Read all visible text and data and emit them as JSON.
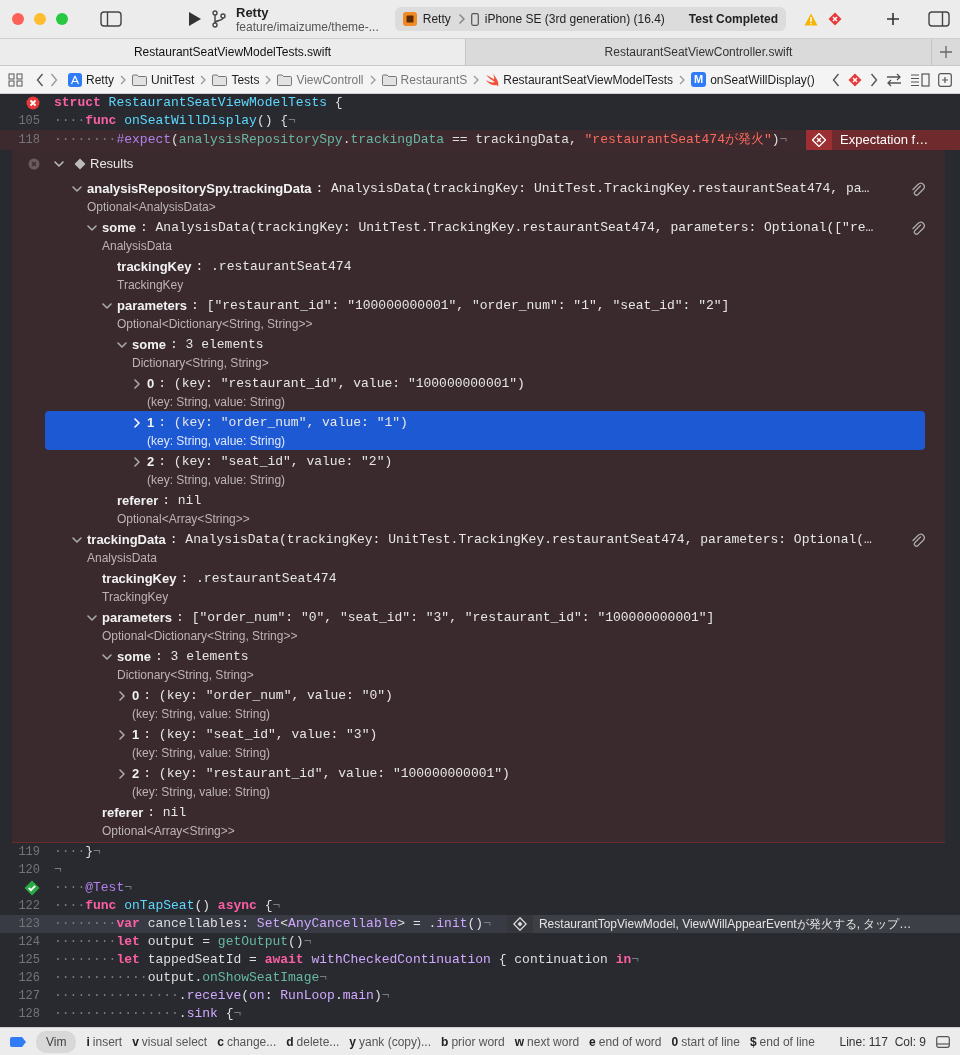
{
  "window": {
    "project": "Retty",
    "branch": "feature/imaizume/theme-...",
    "scheme": "Retty",
    "device": "iPhone SE (3rd generation) (16.4)",
    "status": "Test Completed"
  },
  "tabs": [
    {
      "label": "RestaurantSeatViewModelTests.swift",
      "selected": true
    },
    {
      "label": "RestaurantSeatViewController.swift",
      "selected": false
    }
  ],
  "breadcrumbs": [
    {
      "label": "Retty",
      "kind": "project"
    },
    {
      "label": "UnitTest",
      "kind": "folder"
    },
    {
      "label": "Tests",
      "kind": "folder"
    },
    {
      "label": "ViewControll",
      "kind": "folder"
    },
    {
      "label": "RestaurantS",
      "kind": "folder"
    },
    {
      "label": "RestaurantSeatViewModelTests",
      "kind": "swift"
    },
    {
      "label": "onSeatWillDisplay()",
      "kind": "method",
      "badge": "M"
    }
  ],
  "code_top": [
    {
      "kind": "error",
      "failed": false,
      "current": false,
      "tokens": [
        {
          "kind": "kw",
          "text": "struct"
        },
        {
          "kind": "decl",
          "text": " RestaurantSeatViewModelTests"
        },
        {
          "kind": "plain",
          "text": " {"
        }
      ]
    },
    {
      "kind": "numbered",
      "number": "105",
      "failed": false,
      "current": false,
      "tokens": [
        {
          "kind": "ws",
          "text": "····"
        },
        {
          "kind": "kw",
          "text": "func"
        },
        {
          "kind": "decl",
          "text": " onSeatWillDisplay"
        },
        {
          "kind": "plain",
          "text": "() {"
        },
        {
          "kind": "eol",
          "text": "¬"
        }
      ]
    },
    {
      "kind": "numbered",
      "number": "118",
      "failed": true,
      "current": false,
      "tokens": [
        {
          "kind": "ws",
          "text": "········"
        },
        {
          "kind": "attr",
          "text": "#expect"
        },
        {
          "kind": "plain",
          "text": "("
        },
        {
          "kind": "fn",
          "text": "analysisRepositorySpy"
        },
        {
          "kind": "plain",
          "text": "."
        },
        {
          "kind": "fn",
          "text": "trackingData"
        },
        {
          "kind": "plain",
          "text": " == trackingData, "
        },
        {
          "kind": "str",
          "text": "\"restaurantSeat474が発火\""
        },
        {
          "kind": "plain",
          "text": ")"
        },
        {
          "kind": "eol",
          "text": "¬"
        }
      ],
      "annotation": {
        "kind": "error",
        "text": "Expectation f…"
      }
    }
  ],
  "results": {
    "title": "Results",
    "nodes": [
      {
        "name": "analysisRepositorySpy.trackingData",
        "value": ": AnalysisData(trackingKey: UnitTest.TrackingKey.restaurantSeat474, pa…",
        "type": "Optional<AnalysisData>",
        "kind": "branch",
        "expanded": true,
        "attachment": true,
        "selected": false,
        "children": [
          {
            "name": "some",
            "value": ": AnalysisData(trackingKey: UnitTest.TrackingKey.restaurantSeat474, parameters: Optional([\"re…",
            "type": "AnalysisData",
            "kind": "branch",
            "expanded": true,
            "attachment": true,
            "selected": false,
            "children": [
              {
                "name": "trackingKey",
                "value": ": .restaurantSeat474",
                "type": "TrackingKey",
                "kind": "leaf",
                "selected": false
              },
              {
                "name": "parameters",
                "value": ": [\"restaurant_id\": \"100000000001\", \"order_num\": \"1\", \"seat_id\": \"2\"]",
                "type": "Optional<Dictionary<String, String>>",
                "kind": "branch",
                "expanded": true,
                "selected": false,
                "children": [
                  {
                    "name": "some",
                    "value": ": 3 elements",
                    "type": "Dictionary<String, String>",
                    "kind": "branch",
                    "expanded": true,
                    "selected": false,
                    "children": [
                      {
                        "name": "0",
                        "value": ": (key: \"restaurant_id\", value: \"100000000001\")",
                        "type": "(key: String, value: String)",
                        "kind": "branch",
                        "expanded": false,
                        "selected": false
                      },
                      {
                        "name": "1",
                        "value": ": (key: \"order_num\", value: \"1\")",
                        "type": "(key: String, value: String)",
                        "kind": "branch",
                        "expanded": false,
                        "selected": true
                      },
                      {
                        "name": "2",
                        "value": ": (key: \"seat_id\", value: \"2\")",
                        "type": "(key: String, value: String)",
                        "kind": "branch",
                        "expanded": false,
                        "selected": false
                      }
                    ]
                  }
                ]
              },
              {
                "name": "referer",
                "value": ": nil",
                "type": "Optional<Array<String>>",
                "kind": "leaf",
                "selected": false
              }
            ]
          }
        ]
      },
      {
        "name": "trackingData",
        "value": ": AnalysisData(trackingKey: UnitTest.TrackingKey.restaurantSeat474, parameters: Optional(…",
        "type": "AnalysisData",
        "kind": "branch",
        "expanded": true,
        "attachment": true,
        "selected": false,
        "children": [
          {
            "name": "trackingKey",
            "value": ": .restaurantSeat474",
            "type": "TrackingKey",
            "kind": "leaf",
            "selected": false
          },
          {
            "name": "parameters",
            "value": ": [\"order_num\": \"0\", \"seat_id\": \"3\", \"restaurant_id\": \"100000000001\"]",
            "type": "Optional<Dictionary<String, String>>",
            "kind": "branch",
            "expanded": true,
            "selected": false,
            "children": [
              {
                "name": "some",
                "value": ": 3 elements",
                "type": "Dictionary<String, String>",
                "kind": "branch",
                "expanded": true,
                "selected": false,
                "children": [
                  {
                    "name": "0",
                    "value": ": (key: \"order_num\", value: \"0\")",
                    "type": "(key: String, value: String)",
                    "kind": "branch",
                    "expanded": false,
                    "selected": false
                  },
                  {
                    "name": "1",
                    "value": ": (key: \"seat_id\", value: \"3\")",
                    "type": "(key: String, value: String)",
                    "kind": "branch",
                    "expanded": false,
                    "selected": false
                  },
                  {
                    "name": "2",
                    "value": ": (key: \"restaurant_id\", value: \"100000000001\")",
                    "type": "(key: String, value: String)",
                    "kind": "branch",
                    "expanded": false,
                    "selected": false
                  }
                ]
              }
            ]
          },
          {
            "name": "referer",
            "value": ": nil",
            "type": "Optional<Array<String>>",
            "kind": "leaf",
            "selected": false
          }
        ]
      }
    ]
  },
  "code_bottom": [
    {
      "kind": "numbered",
      "number": "119",
      "failed": false,
      "current": false,
      "tokens": [
        {
          "kind": "ws",
          "text": "····"
        },
        {
          "kind": "plain",
          "text": "}"
        },
        {
          "kind": "eol",
          "text": "¬"
        }
      ]
    },
    {
      "kind": "numbered",
      "number": "120",
      "failed": false,
      "current": false,
      "tokens": [
        {
          "kind": "eol",
          "text": "¬"
        }
      ]
    },
    {
      "kind": "pass",
      "failed": false,
      "current": false,
      "tokens": [
        {
          "kind": "ws",
          "text": "····"
        },
        {
          "kind": "attr",
          "text": "@Test"
        },
        {
          "kind": "eol",
          "text": "¬"
        }
      ]
    },
    {
      "kind": "numbered",
      "number": "122",
      "failed": false,
      "current": false,
      "tokens": [
        {
          "kind": "ws",
          "text": "····"
        },
        {
          "kind": "kw",
          "text": "func"
        },
        {
          "kind": "decl",
          "text": " onTapSeat"
        },
        {
          "kind": "plain",
          "text": "() "
        },
        {
          "kind": "kw",
          "text": "async"
        },
        {
          "kind": "plain",
          "text": " {"
        },
        {
          "kind": "eol",
          "text": "¬"
        }
      ]
    },
    {
      "kind": "numbered",
      "number": "123",
      "failed": false,
      "current": true,
      "tokens": [
        {
          "kind": "ws",
          "text": "········"
        },
        {
          "kind": "kw",
          "text": "var"
        },
        {
          "kind": "plain",
          "text": " cancellables: "
        },
        {
          "kind": "sys",
          "text": "Set"
        },
        {
          "kind": "plain",
          "text": "<"
        },
        {
          "kind": "sys",
          "text": "AnyCancellable"
        },
        {
          "kind": "plain",
          "text": "> = ."
        },
        {
          "kind": "sys",
          "text": "init"
        },
        {
          "kind": "plain",
          "text": "()"
        },
        {
          "kind": "eol",
          "text": "¬"
        }
      ],
      "annotation": {
        "kind": "issue",
        "text": "RestaurantTopViewModel, ViewWillAppearEventが発火する, タップ…"
      }
    },
    {
      "kind": "numbered",
      "number": "124",
      "failed": false,
      "current": false,
      "tokens": [
        {
          "kind": "ws",
          "text": "········"
        },
        {
          "kind": "kw",
          "text": "let"
        },
        {
          "kind": "plain",
          "text": " output = "
        },
        {
          "kind": "fn",
          "text": "getOutput"
        },
        {
          "kind": "plain",
          "text": "()"
        },
        {
          "kind": "eol",
          "text": "¬"
        }
      ]
    },
    {
      "kind": "numbered",
      "number": "125",
      "failed": false,
      "current": false,
      "tokens": [
        {
          "kind": "ws",
          "text": "········"
        },
        {
          "kind": "kw",
          "text": "let"
        },
        {
          "kind": "plain",
          "text": " tappedSeatId = "
        },
        {
          "kind": "kw",
          "text": "await"
        },
        {
          "kind": "sys",
          "text": " withCheckedContinuation"
        },
        {
          "kind": "plain",
          "text": " { continuation "
        },
        {
          "kind": "kw",
          "text": "in"
        },
        {
          "kind": "eol",
          "text": "¬"
        }
      ]
    },
    {
      "kind": "numbered",
      "number": "126",
      "failed": false,
      "current": false,
      "tokens": [
        {
          "kind": "ws",
          "text": "············"
        },
        {
          "kind": "plain",
          "text": "output."
        },
        {
          "kind": "fn",
          "text": "onShowSeatImage"
        },
        {
          "kind": "eol",
          "text": "¬"
        }
      ]
    },
    {
      "kind": "numbered",
      "number": "127",
      "failed": false,
      "current": false,
      "tokens": [
        {
          "kind": "ws",
          "text": "················"
        },
        {
          "kind": "plain",
          "text": "."
        },
        {
          "kind": "sys",
          "text": "receive"
        },
        {
          "kind": "plain",
          "text": "("
        },
        {
          "kind": "sys",
          "text": "on"
        },
        {
          "kind": "plain",
          "text": ": "
        },
        {
          "kind": "sys",
          "text": "RunLoop"
        },
        {
          "kind": "plain",
          "text": "."
        },
        {
          "kind": "sys",
          "text": "main"
        },
        {
          "kind": "plain",
          "text": ")"
        },
        {
          "kind": "eol",
          "text": "¬"
        }
      ]
    },
    {
      "kind": "numbered",
      "number": "128",
      "failed": false,
      "current": false,
      "tokens": [
        {
          "kind": "ws",
          "text": "················"
        },
        {
          "kind": "plain",
          "text": "."
        },
        {
          "kind": "sys",
          "text": "sink"
        },
        {
          "kind": "plain",
          "text": " {"
        },
        {
          "kind": "eol",
          "text": "¬"
        }
      ]
    }
  ],
  "status_bar": {
    "mode": "Vim",
    "hints": [
      {
        "key": "i",
        "label": "insert"
      },
      {
        "key": "v",
        "label": "visual select"
      },
      {
        "key": "c",
        "label": "change..."
      },
      {
        "key": "d",
        "label": "delete..."
      },
      {
        "key": "y",
        "label": "yank (copy)..."
      },
      {
        "key": "b",
        "label": "prior word"
      },
      {
        "key": "w",
        "label": "next word"
      },
      {
        "key": "e",
        "label": "end of word"
      },
      {
        "key": "0",
        "label": "start of line"
      },
      {
        "key": "$",
        "label": "end of line"
      }
    ],
    "position": "Line: 117  Col: 9"
  }
}
